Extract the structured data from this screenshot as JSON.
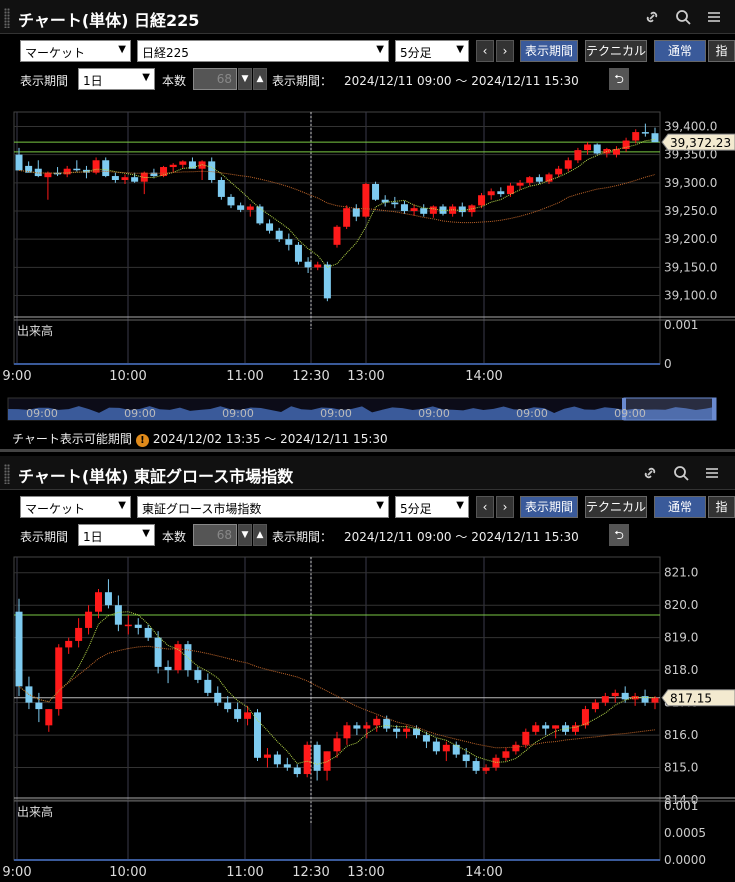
{
  "panels": [
    {
      "title": "チャート(単体) 日経225",
      "market": "マーケット",
      "symbol": "日経225",
      "interval": "5分足",
      "btn_period": "表示期間",
      "btn_technical": "テクニカル",
      "btn_normal": "通常",
      "btn_cut": "指",
      "period_label": "表示期間",
      "period_value": "1日",
      "count_label": "本数",
      "count_value": "68",
      "range_label": "表示期間：",
      "range_value": "2024/12/11 09:00 ～ 2024/12/11 15:30",
      "volume_label": "出来高",
      "price_tag": "39,372.23",
      "nav_ticks": [
        "09:00",
        "09:00",
        "09:00",
        "09:00",
        "09:00",
        "09:00",
        "09:00"
      ],
      "footer_label": "チャート表示可能期間",
      "footer_value": "2024/12/02 13:35 ～ 2024/12/11 15:30",
      "chart_data": {
        "type": "candlestick",
        "x_ticks": [
          "9:00",
          "10:00",
          "11:00",
          "12:30",
          "13:00",
          "14:00"
        ],
        "y_ticks": [
          "39,400.0",
          "39,350.0",
          "39,300.0",
          "39,250.0",
          "39,200.0",
          "39,150.0",
          "39,100.0"
        ],
        "volume_ticks": [
          "0.001",
          "0"
        ],
        "ylim": [
          39085,
          39415
        ],
        "last_value": 39372.23,
        "hlines": [
          39372.23,
          39355
        ],
        "candles": [
          [
            39350,
            39362,
            39338,
            39322
          ],
          [
            39330,
            39338,
            39328,
            39318
          ],
          [
            39325,
            39340,
            39310,
            39312
          ],
          [
            39310,
            39320,
            39270,
            39318
          ],
          [
            39318,
            39328,
            39312,
            39315
          ],
          [
            39315,
            39330,
            39310,
            39325
          ],
          [
            39325,
            39340,
            39320,
            39323
          ],
          [
            39323,
            39330,
            39308,
            39318
          ],
          [
            39318,
            39345,
            39315,
            39340
          ],
          [
            39340,
            39345,
            39310,
            39312
          ],
          [
            39312,
            39318,
            39300,
            39305
          ],
          [
            39305,
            39315,
            39298,
            39310
          ],
          [
            39310,
            39318,
            39300,
            39302
          ],
          [
            39302,
            39320,
            39280,
            39318
          ],
          [
            39318,
            39325,
            39308,
            39312
          ],
          [
            39312,
            39330,
            39310,
            39328
          ],
          [
            39328,
            39335,
            39318,
            39332
          ],
          [
            39332,
            39340,
            39325,
            39338
          ],
          [
            39338,
            39345,
            39330,
            39325
          ],
          [
            39325,
            39340,
            39305,
            39338
          ],
          [
            39338,
            39345,
            39300,
            39305
          ],
          [
            39305,
            39310,
            39270,
            39275
          ],
          [
            39275,
            39280,
            39255,
            39260
          ],
          [
            39260,
            39265,
            39248,
            39252
          ],
          [
            39252,
            39262,
            39240,
            39258
          ],
          [
            39258,
            39262,
            39225,
            39228
          ],
          [
            39228,
            39235,
            39210,
            39215
          ],
          [
            39215,
            39220,
            39195,
            39200
          ],
          [
            39200,
            39210,
            39180,
            39190
          ],
          [
            39190,
            39195,
            39155,
            39160
          ],
          [
            39160,
            39168,
            39140,
            39150
          ],
          [
            39150,
            39160,
            39145,
            39155
          ],
          [
            39155,
            39160,
            39090,
            39095
          ],
          [
            39190,
            39225,
            39185,
            39222
          ],
          [
            39222,
            39260,
            39218,
            39255
          ],
          [
            39255,
            39262,
            39232,
            39240
          ],
          [
            39240,
            39300,
            39238,
            39298
          ],
          [
            39298,
            39302,
            39268,
            39270
          ],
          [
            39270,
            39278,
            39258,
            39265
          ],
          [
            39265,
            39275,
            39255,
            39262
          ],
          [
            39262,
            39268,
            39245,
            39250
          ],
          [
            39250,
            39262,
            39242,
            39255
          ],
          [
            39255,
            39262,
            39240,
            39245
          ],
          [
            39245,
            39260,
            39238,
            39258
          ],
          [
            39258,
            39262,
            39242,
            39245
          ],
          [
            39245,
            39262,
            39240,
            39258
          ],
          [
            39258,
            39265,
            39240,
            39248
          ],
          [
            39248,
            39262,
            39240,
            39260
          ],
          [
            39260,
            39282,
            39255,
            39278
          ],
          [
            39278,
            39290,
            39270,
            39285
          ],
          [
            39285,
            39292,
            39275,
            39280
          ],
          [
            39280,
            39300,
            39275,
            39295
          ],
          [
            39295,
            39305,
            39288,
            39300
          ],
          [
            39300,
            39312,
            39295,
            39310
          ],
          [
            39310,
            39315,
            39298,
            39302
          ],
          [
            39302,
            39318,
            39298,
            39315
          ],
          [
            39315,
            39330,
            39310,
            39325
          ],
          [
            39325,
            39345,
            39320,
            39340
          ],
          [
            39340,
            39362,
            39335,
            39358
          ],
          [
            39358,
            39372,
            39350,
            39368
          ],
          [
            39368,
            39370,
            39350,
            39352
          ],
          [
            39352,
            39362,
            39345,
            39360
          ],
          [
            39350,
            39365,
            39345,
            39360
          ],
          [
            39360,
            39380,
            39355,
            39375
          ],
          [
            39375,
            39395,
            39370,
            39390
          ],
          [
            39390,
            39405,
            39382,
            39388
          ],
          [
            39388,
            39398,
            39380,
            39372
          ]
        ]
      }
    },
    {
      "title": "チャート(単体) 東証グロース市場指数",
      "market": "マーケット",
      "symbol": "東証グロース市場指数",
      "interval": "5分足",
      "btn_period": "表示期間",
      "btn_technical": "テクニカル",
      "btn_normal": "通常",
      "btn_cut": "指",
      "period_label": "表示期間",
      "period_value": "1日",
      "count_label": "本数",
      "count_value": "68",
      "range_label": "表示期間：",
      "range_value": "2024/12/11 09:00 ～ 2024/12/11 15:30",
      "volume_label": "出来高",
      "price_tag": "817.15",
      "chart_data": {
        "type": "candlestick",
        "x_ticks": [
          "9:00",
          "10:00",
          "11:00",
          "12:30",
          "13:00",
          "14:00"
        ],
        "y_ticks": [
          "821.0",
          "820.0",
          "819.0",
          "818.0",
          "817.0",
          "816.0",
          "815.0",
          "814.0"
        ],
        "volume_ticks": [
          "0.001",
          "0.0005",
          "0.0000"
        ],
        "ylim": [
          813.6,
          821.3
        ],
        "last_value": 817.15,
        "hlines": [
          819.7,
          817.15
        ],
        "candles": [
          [
            819.8,
            820.2,
            817.2,
            817.5
          ],
          [
            817.5,
            817.8,
            816.8,
            817.0
          ],
          [
            817.0,
            817.3,
            816.4,
            816.8
          ],
          [
            816.3,
            816.8,
            816.1,
            816.8
          ],
          [
            816.8,
            818.8,
            816.6,
            818.7
          ],
          [
            818.7,
            819.0,
            818.5,
            818.9
          ],
          [
            818.9,
            819.6,
            818.7,
            819.3
          ],
          [
            819.3,
            820.0,
            819.1,
            819.8
          ],
          [
            819.8,
            820.5,
            819.6,
            820.4
          ],
          [
            820.4,
            820.8,
            819.9,
            820.0
          ],
          [
            820.0,
            820.3,
            819.2,
            819.4
          ],
          [
            819.4,
            819.7,
            819.1,
            819.4
          ],
          [
            819.4,
            819.6,
            819.1,
            819.3
          ],
          [
            819.3,
            819.4,
            818.9,
            819.0
          ],
          [
            819.0,
            819.2,
            817.9,
            818.1
          ],
          [
            818.1,
            818.3,
            817.6,
            818.0
          ],
          [
            818.0,
            818.9,
            817.9,
            818.8
          ],
          [
            818.8,
            818.9,
            817.8,
            818.0
          ],
          [
            818.0,
            818.1,
            817.6,
            817.7
          ],
          [
            817.7,
            817.9,
            817.2,
            817.3
          ],
          [
            817.3,
            817.5,
            816.9,
            817.0
          ],
          [
            817.0,
            817.2,
            816.7,
            816.8
          ],
          [
            816.8,
            817.0,
            816.4,
            816.5
          ],
          [
            816.5,
            816.9,
            816.3,
            816.7
          ],
          [
            816.7,
            816.8,
            815.2,
            815.3
          ],
          [
            815.3,
            815.6,
            815.0,
            815.4
          ],
          [
            815.4,
            815.5,
            815.0,
            815.1
          ],
          [
            815.1,
            815.3,
            814.9,
            815.0
          ],
          [
            815.0,
            815.1,
            814.7,
            814.8
          ],
          [
            814.8,
            815.8,
            814.7,
            815.7
          ],
          [
            815.7,
            815.8,
            814.6,
            814.9
          ],
          [
            814.9,
            815.5,
            814.6,
            815.5
          ],
          [
            815.5,
            816.1,
            815.3,
            815.9
          ],
          [
            815.9,
            816.4,
            815.7,
            816.3
          ],
          [
            816.3,
            816.4,
            816.0,
            816.2
          ],
          [
            816.2,
            816.4,
            815.9,
            816.3
          ],
          [
            816.3,
            816.6,
            816.1,
            816.5
          ],
          [
            816.5,
            816.6,
            816.1,
            816.2
          ],
          [
            816.2,
            816.3,
            815.9,
            816.1
          ],
          [
            816.1,
            816.3,
            815.9,
            816.2
          ],
          [
            816.2,
            816.3,
            815.9,
            816.0
          ],
          [
            816.0,
            816.1,
            815.6,
            815.8
          ],
          [
            815.8,
            815.9,
            815.4,
            815.5
          ],
          [
            815.5,
            815.8,
            815.2,
            815.7
          ],
          [
            815.7,
            815.8,
            815.3,
            815.4
          ],
          [
            815.4,
            815.6,
            815.0,
            815.2
          ],
          [
            815.2,
            815.3,
            814.8,
            814.9
          ],
          [
            814.9,
            815.1,
            814.8,
            815.0
          ],
          [
            815.0,
            815.4,
            814.9,
            815.3
          ],
          [
            815.3,
            815.6,
            815.2,
            815.5
          ],
          [
            815.5,
            815.8,
            815.4,
            815.7
          ],
          [
            815.7,
            816.2,
            815.6,
            816.1
          ],
          [
            816.1,
            816.4,
            816.0,
            816.3
          ],
          [
            816.3,
            816.4,
            816.0,
            816.2
          ],
          [
            816.2,
            816.3,
            815.9,
            816.3
          ],
          [
            816.3,
            816.4,
            816.0,
            816.1
          ],
          [
            816.1,
            816.4,
            816.0,
            816.3
          ],
          [
            816.3,
            816.9,
            816.2,
            816.8
          ],
          [
            816.8,
            817.1,
            816.7,
            817.0
          ],
          [
            817.0,
            817.3,
            816.9,
            817.2
          ],
          [
            817.2,
            817.4,
            817.0,
            817.3
          ],
          [
            817.3,
            817.5,
            817.0,
            817.1
          ],
          [
            817.1,
            817.3,
            816.9,
            817.2
          ],
          [
            817.2,
            817.4,
            816.9,
            817.0
          ],
          [
            817.0,
            817.2,
            816.8,
            817.15
          ]
        ]
      }
    }
  ]
}
